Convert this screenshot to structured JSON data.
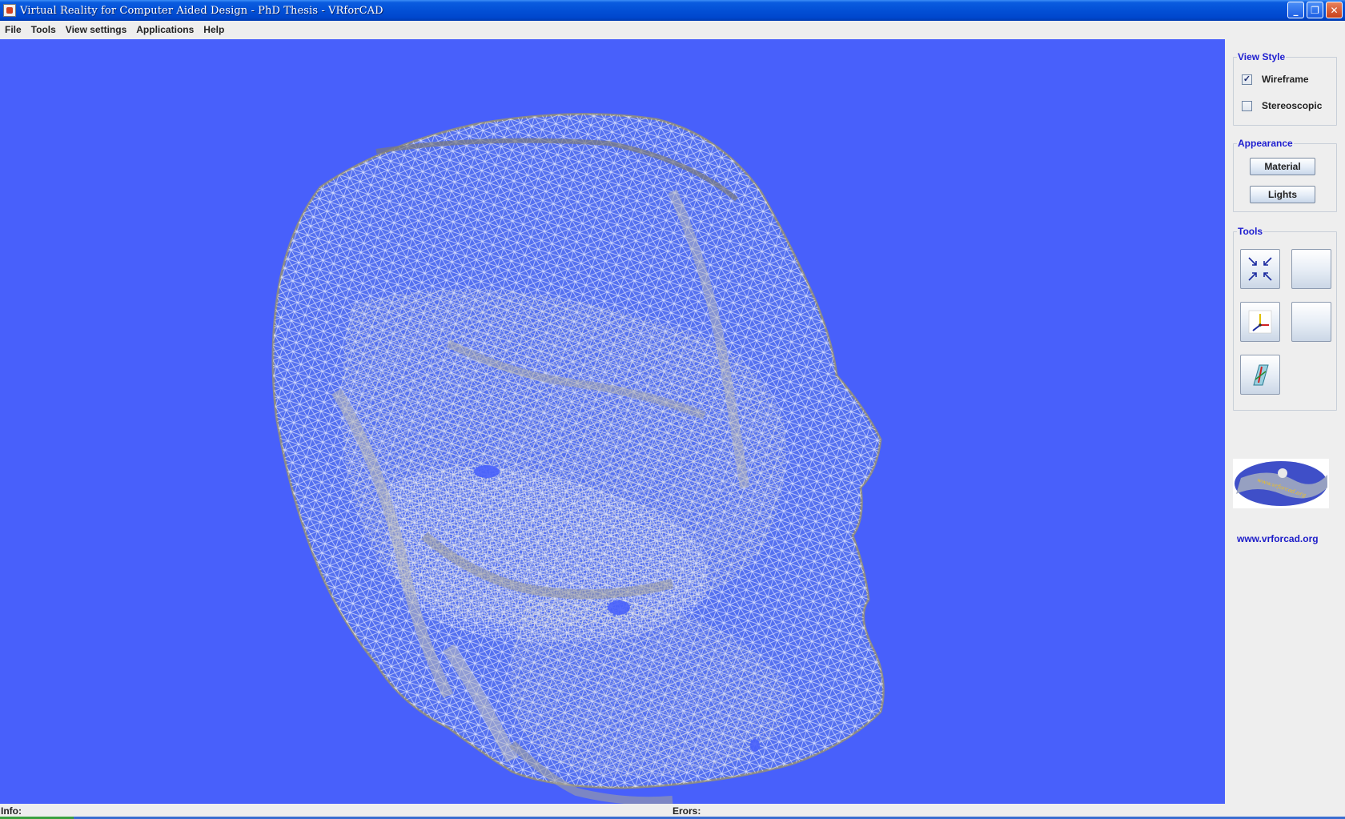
{
  "window": {
    "title": "Virtual Reality for Computer Aided Design - PhD Thesis  - VRforCAD",
    "controls": [
      "minimize-icon",
      "restore-icon",
      "close-icon"
    ]
  },
  "menu": {
    "items": [
      "File",
      "Tools",
      "View settings",
      "Applications",
      "Help"
    ]
  },
  "viewport": {
    "background_color": "#4860fb",
    "render_mode": "wireframe",
    "model": "skull mesh"
  },
  "side_panel": {
    "view_style": {
      "title": "View Style",
      "wireframe_label": "Wireframe",
      "wireframe_checked": true,
      "stereoscopic_label": "Stereoscopic",
      "stereoscopic_checked": false
    },
    "appearance": {
      "title": "Appearance",
      "material_label": "Material",
      "lights_label": "Lights"
    },
    "tools": {
      "title": "Tools",
      "buttons": [
        "fit-view-icon",
        "blank-icon",
        "axes-icon",
        "blank-icon",
        "section-plane-icon"
      ]
    },
    "logo_text": "www.vrforcad.org",
    "website_link": "www.vrforcad.org"
  },
  "status": {
    "info_label": "Info:",
    "errors_label": "Erors:"
  },
  "colors": {
    "title_bar": "#0350d6",
    "viewport": "#4860fb",
    "panel_heading": "#2020d0",
    "link": "#1c1cc8"
  }
}
